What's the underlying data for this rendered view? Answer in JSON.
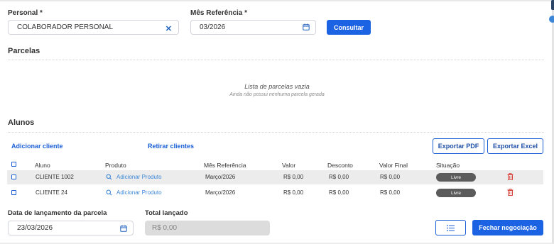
{
  "form": {
    "personal_label": "Personal *",
    "personal_value": "COLABORADOR PERSONAL",
    "mes_label": "Mês Referência *",
    "mes_value": "03/2026",
    "consultar_label": "Consultar"
  },
  "parcelas": {
    "title": "Parcelas",
    "empty_title": "Lista de parcelas vazia",
    "empty_subtitle": "Ainda não possui nenhuma parcela gerada"
  },
  "alunos": {
    "title": "Alunos",
    "add_client": "Adicionar cliente",
    "remove_clients": "Retirar clientes",
    "export_pdf": "Exportar PDF",
    "export_excel": "Exportar Excel",
    "columns": [
      "Aluno",
      "Produto",
      "Mês Referência",
      "Valor",
      "Desconto",
      "Valor Final",
      "Situação"
    ],
    "rows": [
      {
        "aluno": "CLIENTE 1002",
        "produto": "Adicionar Produto",
        "mes": "Março/2026",
        "valor": "R$ 0,00",
        "desconto": "R$ 0,00",
        "valor_final": "R$ 0,00",
        "situacao": "Livre"
      },
      {
        "aluno": "CLIENTE 24",
        "produto": "Adicionar Produto",
        "mes": "Março/2026",
        "valor": "R$ 0,00",
        "desconto": "R$ 0,00",
        "valor_final": "R$ 0,00",
        "situacao": "Livre"
      }
    ]
  },
  "footer": {
    "data_label": "Data de lançamento da parcela",
    "data_value": "23/03/2026",
    "total_label": "Total lançado",
    "total_value": "R$ 0,00",
    "fechar_label": "Fechar negociação"
  },
  "icons": {
    "clear": "close-icon",
    "calendar": "calendar-icon",
    "search": "search-icon",
    "trash": "trash-icon",
    "list": "list-icon"
  },
  "colors": {
    "primary": "#1b63e3",
    "link": "#3b86d6",
    "status_pill": "#5b5b5b",
    "trash": "#d9403a"
  }
}
